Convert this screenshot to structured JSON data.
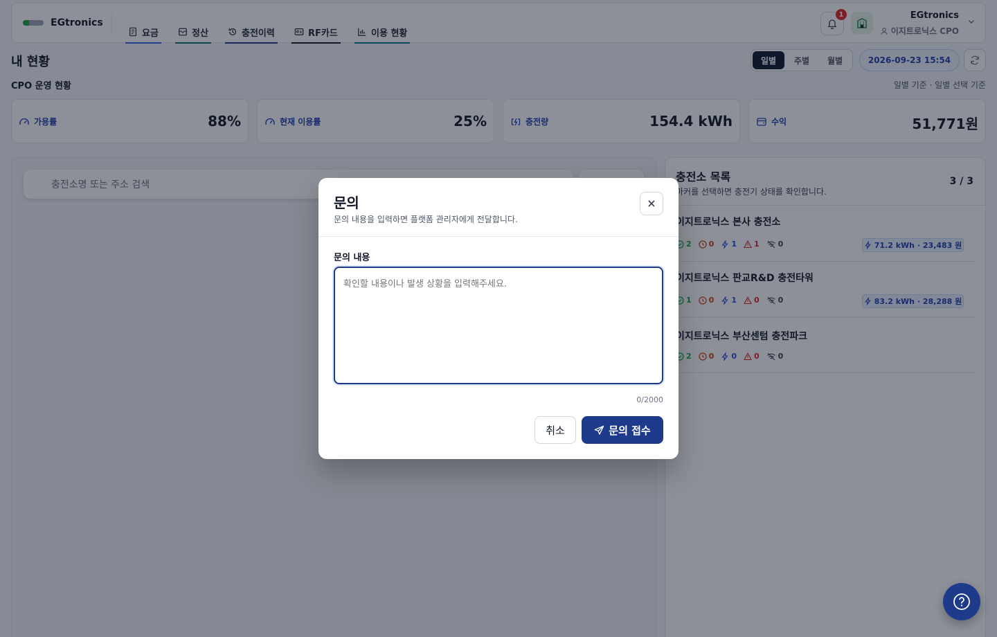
{
  "brand": {
    "name": "EGtronics"
  },
  "nav": [
    {
      "label": "요금",
      "icon": "document-icon",
      "color": "#2563eb"
    },
    {
      "label": "정산",
      "icon": "inbox-icon",
      "color": "#0f766e"
    },
    {
      "label": "충전이력",
      "icon": "history-icon",
      "color": "#1e3a8a"
    },
    {
      "label": "RF카드",
      "icon": "id-card-icon",
      "color": "#111827"
    },
    {
      "label": "이용 현황",
      "icon": "bar-chart-icon",
      "color": "#0e7490"
    }
  ],
  "header": {
    "notification_count": "1",
    "user_name": "EGtronics",
    "user_role": "이지트로닉스 CPO"
  },
  "page": {
    "title": "내 현황",
    "period_tabs": [
      "일별",
      "주별",
      "월별"
    ],
    "active_period": "일별",
    "datetime": "2026-09-23 15:54",
    "section_label": "CPO 운영 현황",
    "section_note": "일별 기준 · 일별 선택 기준"
  },
  "kpis": [
    {
      "label": "가용률",
      "value": "88%",
      "icon": "gauge-icon"
    },
    {
      "label": "현재 이용률",
      "value": "25%",
      "icon": "gauge-icon"
    },
    {
      "label": "충전량",
      "value": "154.4 kWh",
      "icon": "battery-charging-icon"
    },
    {
      "label": "수익",
      "value": "51,771원",
      "icon": "wallet-icon"
    }
  ],
  "map": {
    "search_placeholder": "충전소명 또는 주소 검색"
  },
  "stations_panel": {
    "title": "충전소 목록",
    "subtitle": "마커를 선택하면 충전기 상태를 확인합니다.",
    "count": "3 / 3",
    "stations": [
      {
        "name": "이지트로닉스 본사 충전소",
        "available": "2",
        "waiting": "0",
        "charging": "1",
        "error": "1",
        "offline": "0",
        "summary": "71.2 kWh · 23,483 원"
      },
      {
        "name": "이지트로닉스 판교R&D 충전타워",
        "available": "1",
        "waiting": "0",
        "charging": "1",
        "error": "0",
        "offline": "0",
        "summary": "83.2 kWh · 28,288 원"
      },
      {
        "name": "이지트로닉스 부산센텀 충전파크",
        "available": "2",
        "waiting": "0",
        "charging": "0",
        "error": "0",
        "offline": "0",
        "summary": ""
      }
    ]
  },
  "dialog": {
    "title": "문의",
    "description": "문의 내용을 입력하면 플랫폼 관리자에게 전달합니다.",
    "field_label": "문의 내용",
    "placeholder": "확인할 내용이나 발생 상황을 입력해주세요.",
    "value": "",
    "counter": "0/2000",
    "cancel_label": "취소",
    "submit_label": "문의 접수"
  },
  "colors": {
    "primary": "#1e3a8a",
    "accent": "#1e40af",
    "available": "#16a34a",
    "waiting": "#c2410c",
    "charging": "#1d4ed8",
    "error": "#dc2626",
    "offline": "#6b7280"
  }
}
